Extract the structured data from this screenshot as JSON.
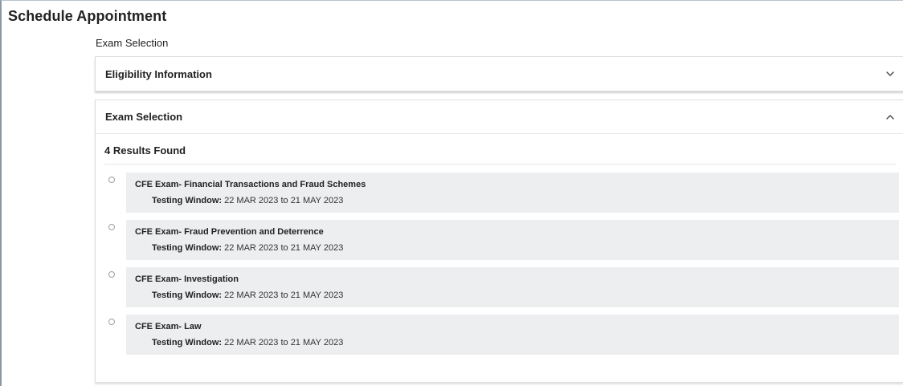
{
  "page": {
    "title": "Schedule Appointment",
    "section_label": "Exam Selection"
  },
  "eligibility_panel": {
    "title": "Eligibility Information",
    "icon": "chevron-down-icon"
  },
  "exam_panel": {
    "title": "Exam Selection",
    "icon": "chevron-up-icon",
    "results_count": "4 Results Found",
    "exams": [
      {
        "name": "CFE Exam- Financial Transactions and Fraud Schemes",
        "window_label": "Testing Window:",
        "window_value": "22 MAR 2023 to 21 MAY 2023",
        "selected": false
      },
      {
        "name": "CFE Exam- Fraud Prevention and Deterrence",
        "window_label": "Testing Window:",
        "window_value": "22 MAR 2023 to 21 MAY 2023",
        "selected": false
      },
      {
        "name": "CFE Exam- Investigation",
        "window_label": "Testing Window:",
        "window_value": "22 MAR 2023 to 21 MAY 2023",
        "selected": false
      },
      {
        "name": "CFE Exam- Law",
        "window_label": "Testing Window:",
        "window_value": "22 MAR 2023 to 21 MAY 2023",
        "selected": false
      }
    ]
  },
  "colors": {
    "card_background": "#eceeef",
    "border": "#dedede",
    "text": "#222222"
  }
}
